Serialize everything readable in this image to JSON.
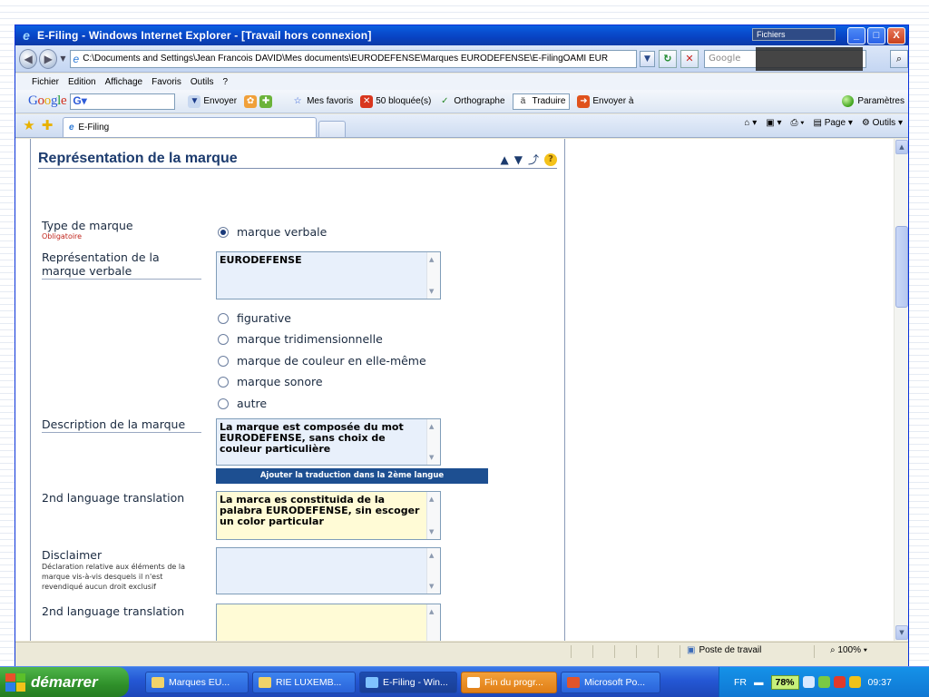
{
  "window": {
    "title": "E-Filing - Windows Internet Explorer - [Travail hors connexion]",
    "overlay_label": "Fichiers",
    "buttons": {
      "minimize": "_",
      "maximize": "□",
      "close": "X"
    }
  },
  "address": {
    "url": "C:\\Documents and Settings\\Jean Francois DAVID\\Mes documents\\EURODEFENSE\\Marques EURODEFENSE\\E-FilingOAMI EUR",
    "search_placeholder": "Google"
  },
  "menu": {
    "items": [
      "Fichier",
      "Edition",
      "Affichage",
      "Favoris",
      "Outils",
      "?"
    ]
  },
  "googlebar": {
    "logo": "Google",
    "send": "Envoyer",
    "favorites": "Mes favoris",
    "blocked": "50 bloquée(s)",
    "spelling": "Orthographe",
    "translate": "Traduire",
    "send_to": "Envoyer à",
    "params": "Paramètres"
  },
  "tabs": {
    "active": "E-Filing",
    "page": "Page",
    "tools": "Outils"
  },
  "form": {
    "section_title": "Représentation de la marque",
    "type_label": "Type de marque",
    "required": "Obligatoire",
    "radios": {
      "verbale": "marque verbale",
      "figurative": "figurative",
      "tridim": "marque tridimensionnelle",
      "couleur": "marque de couleur en elle-même",
      "sonore": "marque sonore",
      "autre": "autre"
    },
    "selected": "verbale",
    "verbal_label": "Représentation de la marque verbale",
    "verbal_value": "EURODEFENSE",
    "description_label": "Description de la marque",
    "description_value": "La marque est composée du mot EURODEFENSE, sans choix de couleur particulière",
    "add_translation": "Ajouter la traduction dans la 2ème langue",
    "translation_label": "2nd language translation",
    "translation_value": "La marca es constituida de la palabra EURODEFENSE, sin escoger un color particular",
    "disclaimer_label": "Disclaimer",
    "disclaimer_note": "Déclaration relative aux éléments de la marque vis-à-vis desquels il n'est revendiqué aucun droit exclusif",
    "translation2_label": "2nd language translation"
  },
  "status": {
    "zone": "Poste de travail",
    "zoom": "100%"
  },
  "taskbar": {
    "start": "démarrer",
    "tasks": [
      "Marques EU...",
      "RIE LUXEMB...",
      "E-Filing - Win...",
      "Fin du progr...",
      "Microsoft Po..."
    ],
    "lang": "FR",
    "battery": "78%",
    "clock": "09:37"
  },
  "colors": {
    "title_blue": "#0842c2",
    "form_heading": "#1c3b6e",
    "required_red": "#c0251c",
    "action_blue": "#1d4f91",
    "translation_yellow": "#fffbd6"
  }
}
